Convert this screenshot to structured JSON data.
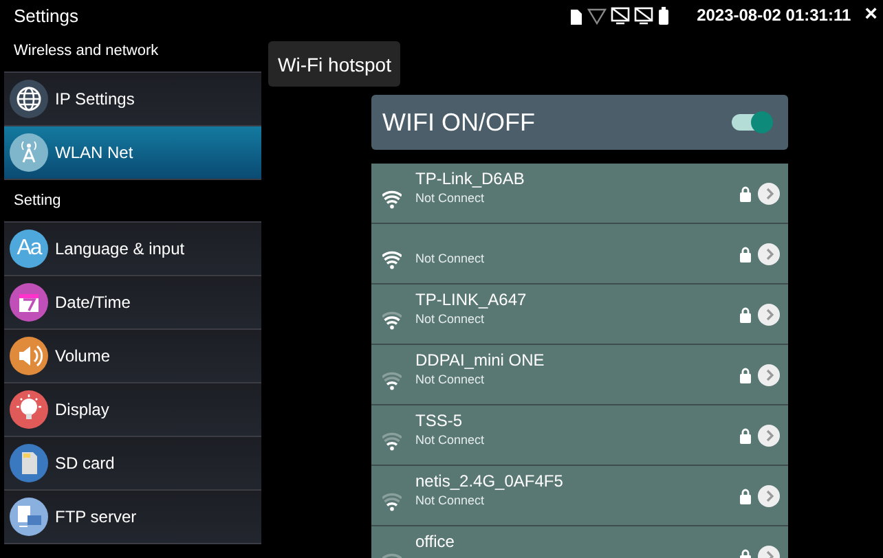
{
  "status_bar": {
    "title": "Settings",
    "datetime": "2023-08-02 01:31:11",
    "close": "×"
  },
  "sidebar": {
    "sections": [
      {
        "header": "Wireless and network",
        "items": [
          {
            "label": "IP Settings",
            "selected": false
          },
          {
            "label": "WLAN Net",
            "selected": true
          }
        ]
      },
      {
        "header": "Setting",
        "items": [
          {
            "label": "Language & input",
            "icon_text": "Aa",
            "selected": false
          },
          {
            "label": "Date/Time",
            "selected": false
          },
          {
            "label": "Volume",
            "selected": false
          },
          {
            "label": "Display",
            "selected": false
          },
          {
            "label": "SD card",
            "selected": false
          },
          {
            "label": "FTP server",
            "selected": false
          }
        ]
      }
    ]
  },
  "hotspot_button": "Wi-Fi hotspot",
  "wifi_toggle": {
    "label": "WIFI ON/OFF",
    "on": true
  },
  "networks": [
    {
      "name": "TP-Link_D6AB",
      "status": "Not Connect",
      "locked": true
    },
    {
      "status": "Not Connect",
      "locked": true
    },
    {
      "name": "TP-LINK_A647",
      "status": "Not Connect",
      "locked": true
    },
    {
      "name": "DDPAI_mini ONE",
      "status": "Not Connect",
      "locked": true
    },
    {
      "name": "TSS-5",
      "status": "Not Connect",
      "locked": true
    },
    {
      "name": "netis_2.4G_0AF4F5",
      "status": "Not Connect",
      "locked": true
    },
    {
      "name": "office",
      "locked": true
    }
  ]
}
